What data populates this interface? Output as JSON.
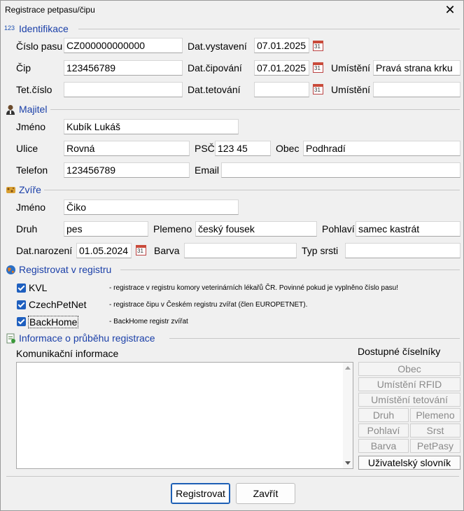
{
  "window": {
    "title": "Registrace petpasu/čipu",
    "close": "✕"
  },
  "ident": {
    "title": "Identifikace",
    "icon_text": "123",
    "cislo_pasu_label": "Číslo pasu",
    "cislo_pasu": "CZ000000000000",
    "dat_vystaveni_label": "Dat.vystavení",
    "dat_vystaveni": "07.01.2025",
    "cip_label": "Čip",
    "cip": "123456789",
    "dat_cipovani_label": "Dat.čipování",
    "dat_cipovani": "07.01.2025",
    "umisteni_label": "Umístění",
    "umisteni_cipu": "Pravá strana krku",
    "tet_cislo_label": "Tet.číslo",
    "tet_cislo": "",
    "dat_tetovani_label": "Dat.tetování",
    "dat_tetovani": "",
    "umisteni2_label": "Umístění",
    "umisteni_tetovani": "",
    "cal_day": "31"
  },
  "majitel": {
    "title": "Majitel",
    "jmeno_label": "Jméno",
    "jmeno": "Kubík Lukáš",
    "ulice_label": "Ulice",
    "ulice": "Rovná",
    "psc_label": "PSČ",
    "psc": "123 45",
    "obec_label": "Obec",
    "obec": "Podhradí",
    "telefon_label": "Telefon",
    "telefon": "123456789",
    "email_label": "Email",
    "email": ""
  },
  "zvire": {
    "title": "Zvíře",
    "jmeno_label": "Jméno",
    "jmeno": "Čiko",
    "druh_label": "Druh",
    "druh": "pes",
    "plemeno_label": "Plemeno",
    "plemeno": "český fousek",
    "pohlavi_label": "Pohlaví",
    "pohlavi": "samec kastrát",
    "dat_narozeni_label": "Dat.narození",
    "dat_narozeni": "01.05.2024",
    "barva_label": "Barva",
    "barva": "",
    "typ_srsti_label": "Typ srsti",
    "typ_srsti": ""
  },
  "registr": {
    "title": "Registrovat v registru",
    "items": [
      {
        "label": "KVL",
        "checked": true,
        "note": "- registrace v registru komory veterinárních lékařů ČR. Povinné pokud je vyplněno číslo pasu!"
      },
      {
        "label": "CzechPetNet",
        "checked": true,
        "note": "- registrace čipu v Českém registru zvířat (člen EUROPETNET)."
      },
      {
        "label": "BackHome",
        "checked": true,
        "note": "- BackHome registr zvířat"
      }
    ]
  },
  "prubeh": {
    "title": "Informace o průběhu registrace",
    "komunikace_label": "Komunikační informace",
    "komunikace": "",
    "ciselniky_label": "Dostupné číselníky",
    "ciselniky": {
      "obec": "Obec",
      "umisteni_rfid": "Umístění RFID",
      "umisteni_tetovani": "Umístění tetování",
      "druh": "Druh",
      "plemeno": "Plemeno",
      "pohlavi": "Pohlaví",
      "srst": "Srst",
      "barva": "Barva",
      "petpasy": "PetPasy",
      "uzivatelsky_slovnik": "Uživatelský slovník"
    }
  },
  "footer": {
    "registrovat": "Registrovat",
    "zavrit": "Zavřít"
  }
}
